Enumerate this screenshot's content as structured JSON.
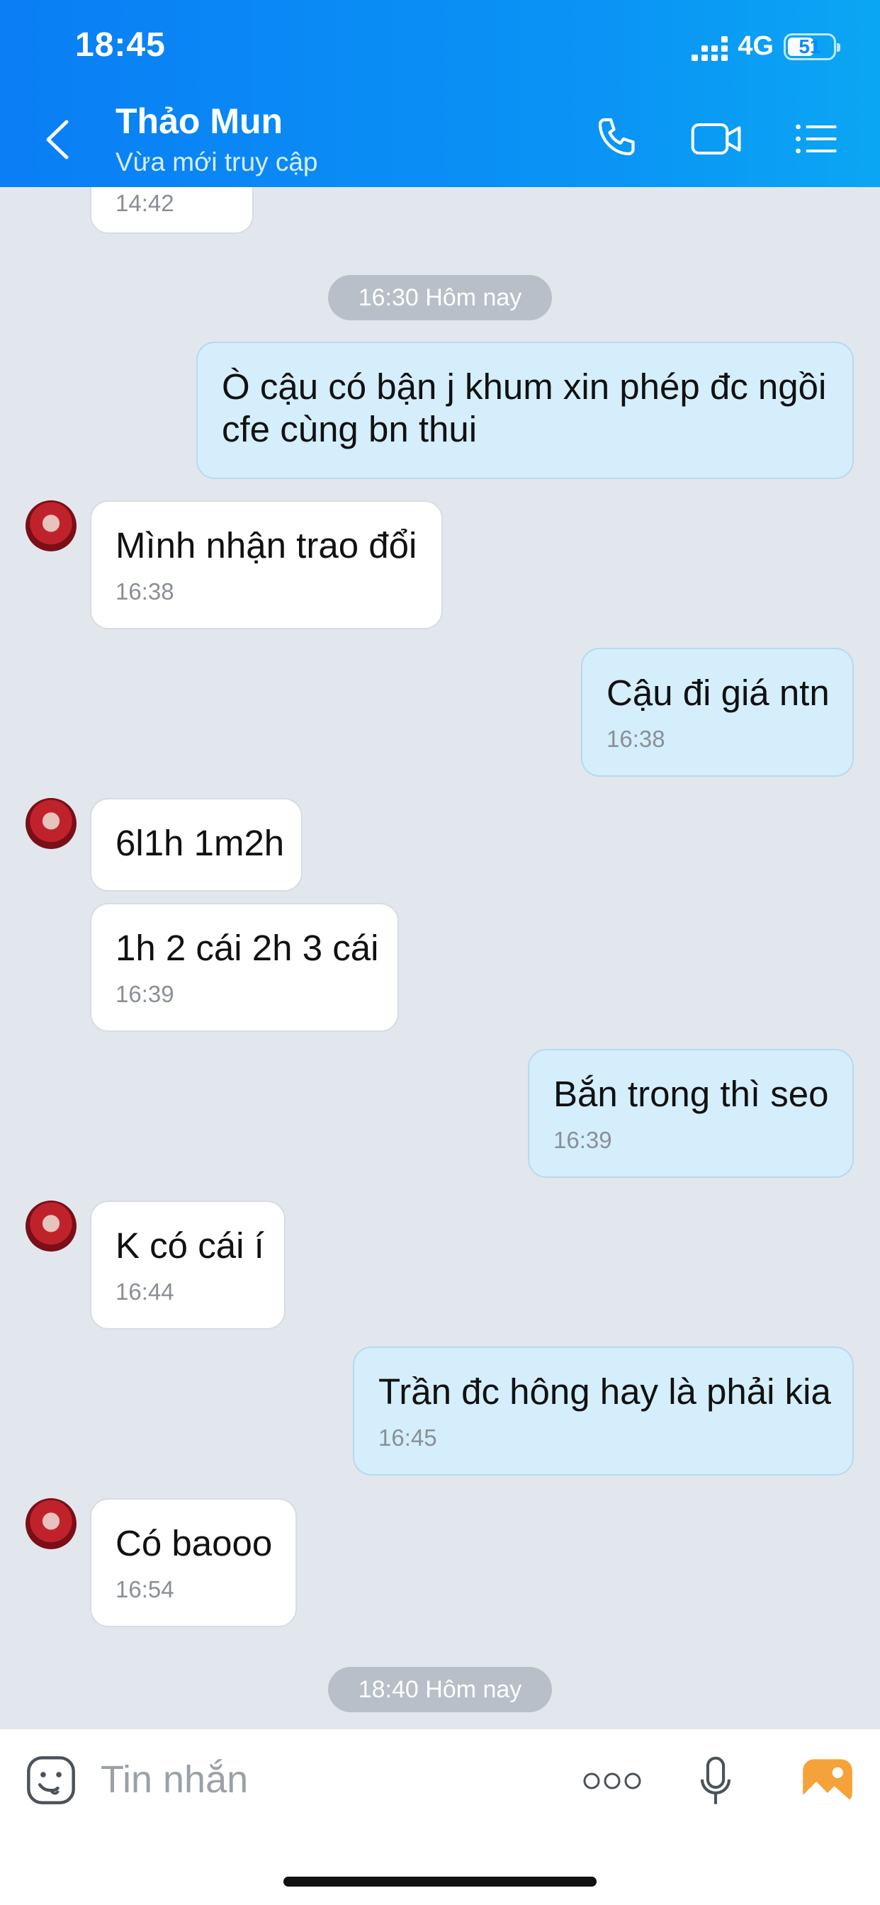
{
  "status_bar": {
    "time": "18:45",
    "network": "4G",
    "battery": "51"
  },
  "header": {
    "contact_name": "Thảo Mun",
    "contact_status": "Vừa mới truy cập"
  },
  "colors": {
    "header": "#0a8af5",
    "incoming_bubble": "#ffffff",
    "outgoing_bubble": "#d4eefb",
    "chat_bg": "#e2e7ee"
  },
  "icons": [
    "back-chevron-icon",
    "phone-icon",
    "video-camera-icon",
    "list-menu-icon",
    "sticker-icon",
    "more-dots-icon",
    "microphone-icon",
    "photo-icon"
  ],
  "chat": {
    "top_partial_time": "14:42",
    "date_pill_1": "16:30 Hôm nay",
    "messages": [
      {
        "dir": "out",
        "text": "Ò cậu có bận j khum xin phép đc ngồi cfe cùng bn thui",
        "time": ""
      },
      {
        "dir": "in",
        "text": "Mình nhận trao đổi",
        "time": "16:38"
      },
      {
        "dir": "out",
        "text": "Cậu đi giá ntn",
        "time": "16:38"
      },
      {
        "dir": "in",
        "text": "6l1h 1m2h",
        "time": ""
      },
      {
        "dir": "in",
        "text": "1h 2 cái 2h 3 cái",
        "time": "16:39"
      },
      {
        "dir": "out",
        "text": "Bắn trong thì seo",
        "time": "16:39"
      },
      {
        "dir": "in",
        "text": "K có cái í",
        "time": "16:44"
      },
      {
        "dir": "out",
        "text": "Trần đc hông hay là phải kia",
        "time": "16:45"
      },
      {
        "dir": "in",
        "text": "Có baooo",
        "time": "16:54"
      }
    ],
    "date_pill_2": "18:40 Hôm nay"
  },
  "input": {
    "placeholder": "Tin nhắn"
  }
}
